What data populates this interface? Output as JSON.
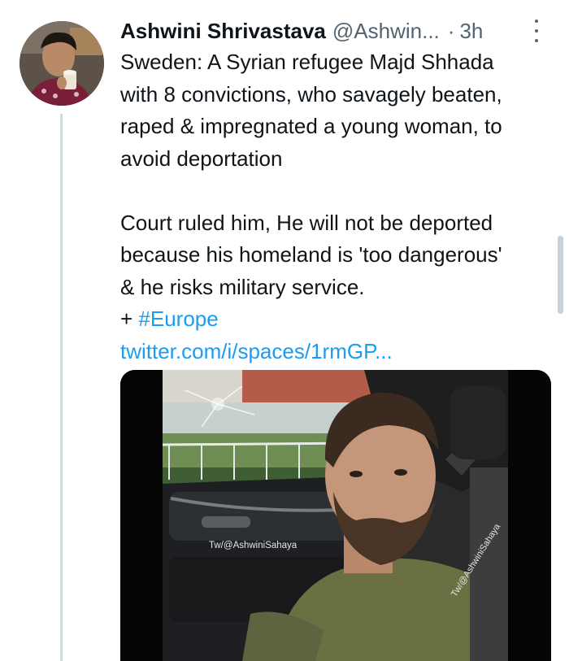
{
  "tweet": {
    "author_name": "Ashwini Shrivastava",
    "author_handle": "@Ashwin...",
    "separator": "·",
    "time": "3h",
    "paragraphs": [
      "Sweden: A Syrian refugee Majd Shhada\nwith 8 convictions, who savagely beaten,\nraped & impregnated a young woman, to\navoid deportation",
      "Court ruled him, He will not be deported\nbecause his homeland is 'too dangerous'\n& he risks military service."
    ],
    "hashtag_prefix": "+ ",
    "hashtag": "#Europe",
    "link": "twitter.com/i/spaces/1rmGP...",
    "media": {
      "watermark_primary": "Tw/@AshwiniSahaya",
      "watermark_secondary": "Tw/@AshwiniSahaya"
    }
  },
  "icons": {
    "more": "more-vertical-icon"
  },
  "colors": {
    "text": "#0f1419",
    "secondary": "#536471",
    "link": "#1d9bf0",
    "thread_line": "#cfd9de"
  }
}
